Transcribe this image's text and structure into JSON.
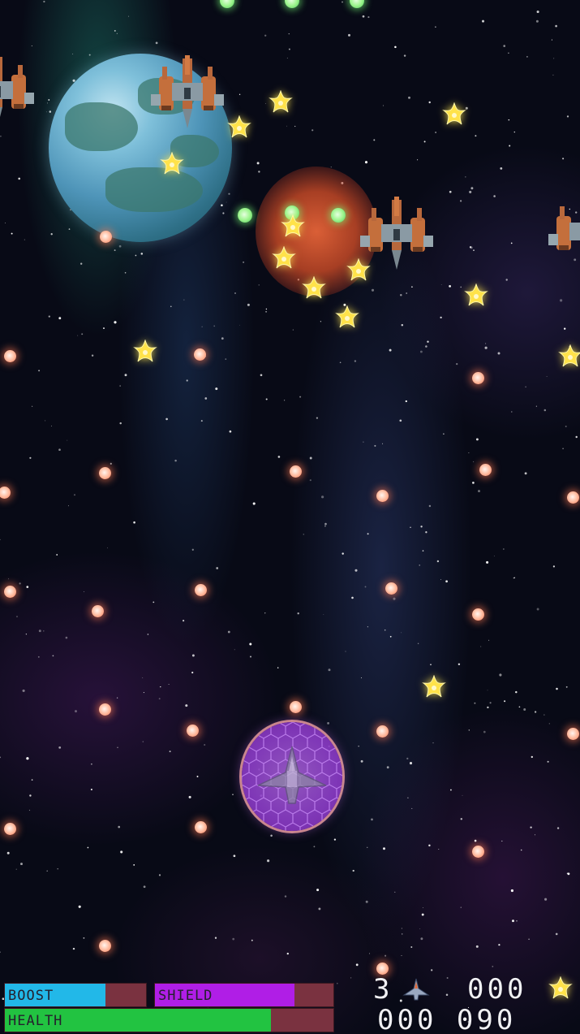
{
  "hud": {
    "boost": {
      "label": "BOOST",
      "level": 0.71,
      "fill_color": "#22b8e8"
    },
    "shield": {
      "label": "SHIELD",
      "level": 0.78,
      "fill_color": "#b01ee6"
    },
    "health": {
      "label": "HEALTH",
      "level": 0.81,
      "fill_color": "#22c341"
    },
    "track_color": "#7a3240",
    "lives": "3",
    "stars_collected": "000",
    "score": "000 090"
  },
  "icons": {
    "lives": "player-ship-icon",
    "stars": "star-icon"
  },
  "colors": {
    "enemy_bullet": "#ff9a7a",
    "player_bullet": "#8ef08a",
    "star_pickup": "#ffe24a",
    "shield_bubble": "#9a4fd6"
  }
}
